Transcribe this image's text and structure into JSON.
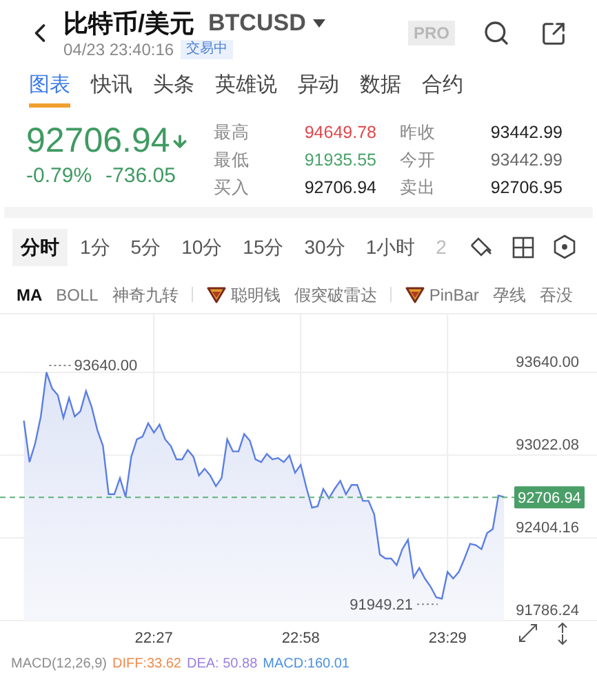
{
  "header": {
    "title": "比特币/美元",
    "symbol": "BTCUSD",
    "time": "04/23 23:40:16",
    "status": "交易中",
    "pro": "PRO"
  },
  "tabs": [
    {
      "label": "图表",
      "selected": true
    },
    {
      "label": "快讯",
      "selected": false
    },
    {
      "label": "头条",
      "selected": false
    },
    {
      "label": "英雄说",
      "selected": false
    },
    {
      "label": "异动",
      "selected": false
    },
    {
      "label": "数据",
      "selected": false
    },
    {
      "label": "合约",
      "selected": false
    }
  ],
  "quote": {
    "price": "92706.94",
    "falling": true,
    "change_pct": "-0.79%",
    "change": "-736.05"
  },
  "stats": [
    {
      "label": "最高",
      "value": "94649.78",
      "color": "#e0474c"
    },
    {
      "label": "昨收",
      "value": "93442.99",
      "color": "#222222"
    },
    {
      "label": "最低",
      "value": "91935.55",
      "color": "#4aa36b"
    },
    {
      "label": "今开",
      "value": "93442.99",
      "color": "#666666"
    },
    {
      "label": "买入",
      "value": "92706.94",
      "color": "#222222"
    },
    {
      "label": "卖出",
      "value": "92706.95",
      "color": "#222222"
    }
  ],
  "periods": [
    {
      "label": "分时",
      "selected": true,
      "faded": false
    },
    {
      "label": "1分",
      "selected": false,
      "faded": false
    },
    {
      "label": "5分",
      "selected": false,
      "faded": false
    },
    {
      "label": "10分",
      "selected": false,
      "faded": false
    },
    {
      "label": "15分",
      "selected": false,
      "faded": false
    },
    {
      "label": "30分",
      "selected": false,
      "faded": false
    },
    {
      "label": "1小时",
      "selected": false,
      "faded": false
    },
    {
      "label": "2",
      "selected": false,
      "faded": true
    }
  ],
  "indicators": [
    {
      "items": [
        {
          "label": "MA",
          "selected": true,
          "kind": "plain"
        },
        {
          "label": "BOLL",
          "selected": false,
          "kind": "plain"
        },
        {
          "label": "神奇九转",
          "selected": false,
          "kind": "plain"
        }
      ]
    },
    {
      "items": [
        {
          "label": "聪明钱",
          "selected": false,
          "kind": "premium"
        },
        {
          "label": "假突破雷达",
          "selected": false,
          "kind": "plain"
        }
      ]
    },
    {
      "items": [
        {
          "label": "PinBar",
          "selected": false,
          "kind": "premium"
        },
        {
          "label": "孕线",
          "selected": false,
          "kind": "plain"
        },
        {
          "label": "吞没",
          "selected": false,
          "kind": "plain"
        }
      ]
    }
  ],
  "chart": {
    "markers": {
      "high": "93640.00",
      "low": "91949.21"
    },
    "chart_data": {
      "type": "area",
      "grid": true,
      "ylim": [
        91786.24,
        94052
      ],
      "ref_lines": [
        {
          "axis": "y",
          "value": 92706.94,
          "label": "92706.94",
          "color": "#5fb37a"
        }
      ],
      "categories": [
        null,
        null,
        null,
        null,
        null,
        null,
        null,
        null,
        null,
        null,
        null,
        null,
        null,
        null,
        null,
        null,
        null,
        null,
        null,
        null,
        null,
        null,
        null,
        "22:27",
        null,
        null,
        null,
        null,
        null,
        null,
        null,
        null,
        null,
        null,
        null,
        null,
        null,
        null,
        null,
        null,
        null,
        null,
        null,
        null,
        null,
        null,
        null,
        null,
        null,
        "22:58",
        null,
        null,
        null,
        null,
        null,
        null,
        null,
        null,
        null,
        null,
        null,
        null,
        null,
        null,
        null,
        null,
        null,
        null,
        null,
        null,
        null,
        null,
        null,
        null,
        null,
        "23:29",
        null,
        null,
        null,
        null,
        null,
        null,
        null,
        null,
        null,
        null
      ],
      "series": [
        {
          "color": "#5b7ee5",
          "values": [
            93280,
            92970,
            93110,
            93310,
            93640,
            93520,
            93470,
            93300,
            93450,
            93310,
            93350,
            93500,
            93380,
            93210,
            93090,
            92730,
            92730,
            92850,
            92710,
            93010,
            93140,
            93160,
            93260,
            93190,
            93250,
            93140,
            93090,
            92990,
            92990,
            93060,
            93010,
            92870,
            92920,
            92870,
            92790,
            92850,
            93140,
            93050,
            93050,
            93180,
            93130,
            92990,
            92970,
            93030,
            92990,
            93000,
            92970,
            93020,
            92890,
            92950,
            92780,
            92630,
            92640,
            92770,
            92700,
            92770,
            92830,
            92730,
            92800,
            92800,
            92680,
            92680,
            92580,
            92280,
            92250,
            92250,
            92200,
            92320,
            92390,
            92110,
            92180,
            92100,
            92040,
            91960,
            91950,
            92150,
            92100,
            92150,
            92250,
            92360,
            92350,
            92320,
            92440,
            92470,
            92720,
            92710
          ]
        }
      ],
      "yticks": [
        {
          "value": 93640,
          "label": "93640.00"
        },
        {
          "value": 93022.08,
          "label": "93022.08"
        },
        {
          "value": 92404.16,
          "label": "92404.16"
        },
        {
          "value": 91786.24,
          "label": "91786.24"
        }
      ]
    }
  },
  "macd": [
    {
      "text": "MACD(12,26,9)",
      "color": "#8c8c8c"
    },
    {
      "text": "DIFF:33.62",
      "color": "#f08a4b"
    },
    {
      "text": "DEA: 50.88",
      "color": "#9a7fe0"
    },
    {
      "text": "MACD:160.01",
      "color": "#4a90e2"
    }
  ]
}
